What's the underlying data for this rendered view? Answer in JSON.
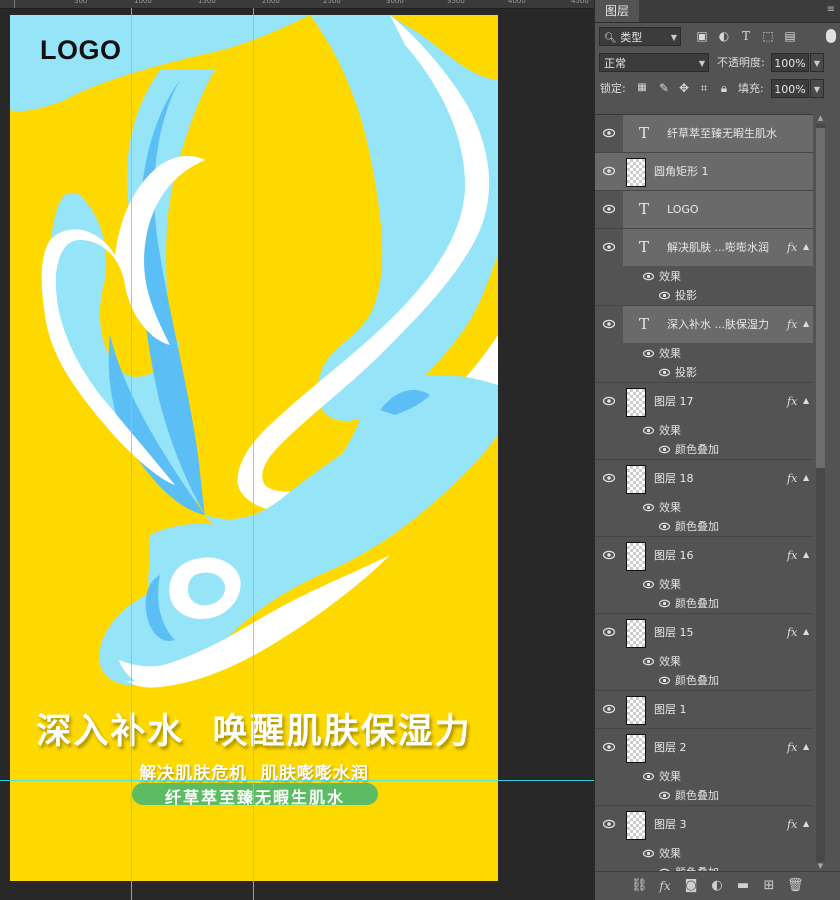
{
  "ruler": {
    "ticks": [
      "500",
      "1000",
      "1500",
      "2000",
      "2500",
      "3000",
      "3500",
      "4000",
      "4500"
    ]
  },
  "poster": {
    "logo": "LOGO",
    "headline": "深入补水  唤醒肌肤保湿力",
    "subline": "解决肌肤危机  肌肤嘭嘭水润",
    "pill_text": "纤草萃至臻无暇生肌水",
    "colors": {
      "background": "#fed900",
      "light_blue": "#95e4f8",
      "mid_blue": "#5bbff5",
      "white": "#ffffff",
      "pill": "#5cbc63"
    }
  },
  "panel": {
    "tab_label": "图层",
    "filter": {
      "label": "类型"
    },
    "blend_mode": "正常",
    "opacity_label": "不透明度:",
    "opacity_value": "100%",
    "lock_label": "锁定:",
    "fill_label": "填充:",
    "fill_value": "100%"
  },
  "layers": {
    "l0": {
      "name": "纤草萃至臻无暇生肌水"
    },
    "l1": {
      "name": "圆角矩形 1"
    },
    "l2": {
      "name": "LOGO"
    },
    "l3": {
      "name": "解决肌肤 ...嘭嘭水润",
      "effects": "效果",
      "effect1": "投影"
    },
    "l4": {
      "name": "深入补水 ...肤保湿力",
      "effects": "效果",
      "effect1": "投影"
    },
    "l5": {
      "name": "图层 17",
      "effects": "效果",
      "effect1": "颜色叠加"
    },
    "l6": {
      "name": "图层 18",
      "effects": "效果",
      "effect1": "颜色叠加"
    },
    "l7": {
      "name": "图层 16",
      "effects": "效果",
      "effect1": "颜色叠加"
    },
    "l8": {
      "name": "图层 15",
      "effects": "效果",
      "effect1": "颜色叠加"
    },
    "l9": {
      "name": "图层 1"
    },
    "l10": {
      "name": "图层 2",
      "effects": "效果",
      "effect1": "颜色叠加"
    },
    "l11": {
      "name": "图层 3",
      "effects": "效果",
      "effect1": "颜色叠加"
    }
  },
  "fx_label": "fx",
  "text_layer_glyph": "T"
}
